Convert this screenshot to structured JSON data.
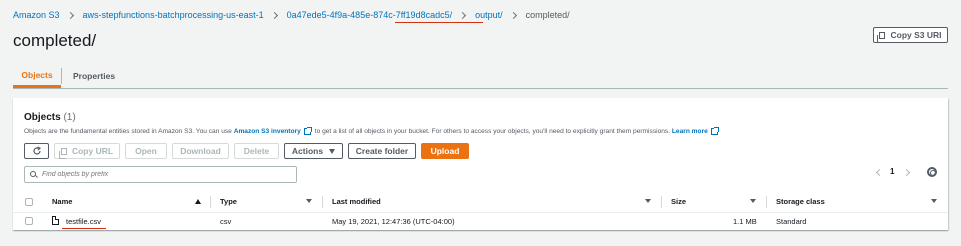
{
  "breadcrumb": {
    "items": [
      "Amazon S3",
      "aws-stepfunctions-batchprocessing-us-east-1",
      "0a47ede5-4f9a-485e-874c-7ff19d8cadc5/",
      "output/",
      "completed/"
    ]
  },
  "page": {
    "title": "completed/",
    "copy_uri_label": "Copy S3 URI"
  },
  "tabs": [
    {
      "label": "Objects",
      "active": true
    },
    {
      "label": "Properties",
      "active": false
    }
  ],
  "objects": {
    "title": "Objects",
    "count": "(1)",
    "description_prefix": "Objects are the fundamental entities stored in Amazon S3. You can use",
    "inventory_link": "Amazon S3 inventory",
    "description_middle": "to get a list of all objects in your bucket. For others to access your objects, you'll need to explicitly grant them permissions.",
    "learn_more": "Learn more",
    "toolbar": {
      "copy_url": "Copy URL",
      "open": "Open",
      "download": "Download",
      "delete": "Delete",
      "actions": "Actions",
      "create_folder": "Create folder",
      "upload": "Upload"
    },
    "search_placeholder": "Find objects by prefix",
    "page_number": "1",
    "columns": [
      "Name",
      "Type",
      "Last modified",
      "Size",
      "Storage class"
    ],
    "rows": [
      {
        "name": "testfile.csv",
        "type": "csv",
        "last_modified": "May 19, 2021, 12:47:36 (UTC-04:00)",
        "size": "1.1 MB",
        "storage_class": "Standard"
      }
    ]
  },
  "colors": {
    "accent": "#ec7211",
    "link": "#0073bb",
    "annotation_underline": "#d13212"
  }
}
